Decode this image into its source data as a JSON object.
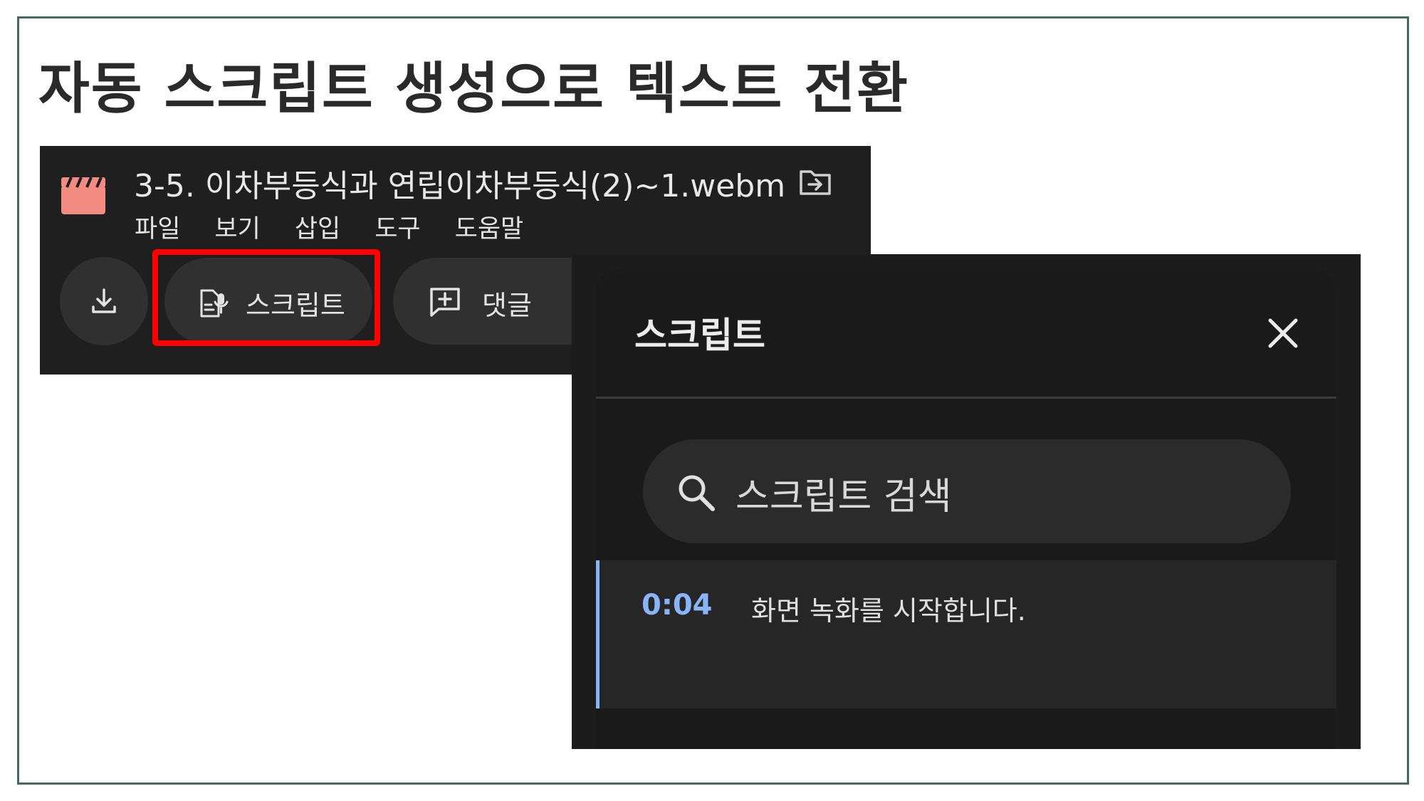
{
  "slide": {
    "title": "자동 스크립트 생성으로 텍스트 전환"
  },
  "editor": {
    "file_name": "3-5. 이차부등식과 연립이차부등식(2)~1.webm",
    "menu": [
      "파일",
      "보기",
      "삽입",
      "도구",
      "도움말"
    ],
    "toolbar": {
      "transcript_label": "스크립트",
      "comment_label": "댓글"
    },
    "icons": {
      "file": "video-clapperboard-icon",
      "move": "move-to-folder-icon",
      "download": "download-icon",
      "transcript": "transcript-icon",
      "comment": "add-comment-icon"
    },
    "colors": {
      "file_icon": "#f28b82",
      "highlight": "#ff0000"
    }
  },
  "transcript_panel": {
    "title": "스크립트",
    "search_placeholder": "스크립트 검색",
    "entries": [
      {
        "time": "0:04",
        "text": "화면 녹화를 시작합니다."
      }
    ],
    "colors": {
      "accent": "#8ab4f8"
    }
  }
}
